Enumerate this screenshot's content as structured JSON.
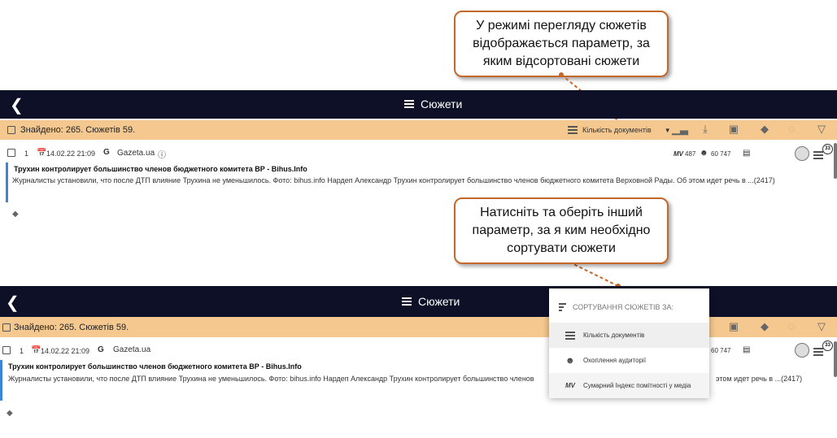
{
  "callouts": {
    "top": {
      "line1": "У режимі перегляду сюжетів",
      "line2": "відображається параметр, за",
      "line3": "яким відсортовані сюжети"
    },
    "bottom": {
      "line1": "Натисніть та оберіть інший",
      "line2": "параметр, за я ким необхідно",
      "line3": "сортувати сюжети"
    }
  },
  "header": {
    "title": "Сюжети",
    "back": "❮"
  },
  "filterbar": {
    "found_text": "Знайдено: 265. Сюжетів 59.",
    "sort_label": "Кількість документів"
  },
  "story": {
    "index": "1",
    "datetime": "14.02.22 21:09",
    "source": "Gazeta.ua",
    "source_logo": "G",
    "headline": "Трухин контролирует большинство членов бюджетного комитета ВР - Bihus.Info",
    "snippet_top": "Журналисты установили, что после ДТП влияние Трухина не уменьшилось. Фото: bihus.info Нардеп Александр Трухин контролирует большинство членов бюджетного комитета Верховной Рады. Об этом идет речь в ...(2417)",
    "snippet_bottom_left": "Журналисты установили, что после ДТП влияние Трухина не уменьшилось. Фото: bihus.info Нардеп Александр Трухин контролирует большинство членов",
    "snippet_bottom_right": "этом идет речь в ...(2417)",
    "mv_label": "MV",
    "mv_value": "487",
    "audience": "60 747",
    "audience_short": "60 747",
    "badge": "33"
  },
  "dropdown": {
    "title": "СОРТУВАННЯ СЮЖЕТІВ ЗА:",
    "items": [
      {
        "label": "Кількість документів"
      },
      {
        "label": "Охоплення аудиторії"
      },
      {
        "label": "Сумарний Індекс помітності у медіа"
      }
    ],
    "mv_glyph": "MV"
  },
  "colors": {
    "header_bg": "#0e1028",
    "filter_bg": "#f4c88f",
    "callout_border": "#c4682b",
    "accent_bar": "#3a86d4"
  }
}
